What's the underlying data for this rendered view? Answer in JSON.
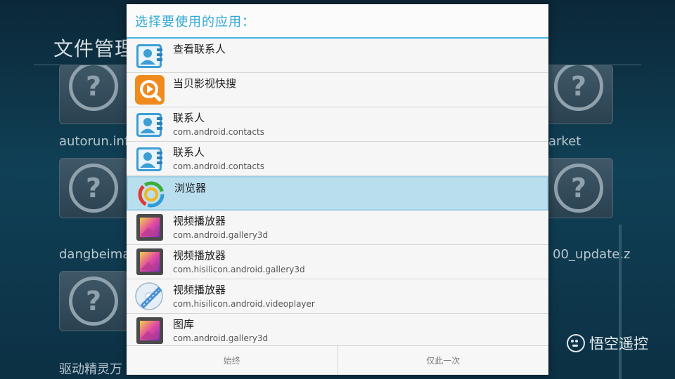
{
  "background": {
    "title": "文件管理",
    "labels": {
      "autorun": "autorun.inf",
      "market": "arket",
      "dangbei": "dangbeima",
      "update": "00_update.z",
      "driver": "驱动精灵万"
    }
  },
  "watermark": {
    "text": "悟空遥控"
  },
  "dialog": {
    "title": "选择要使用的应用：",
    "items": [
      {
        "name": "查看联系人",
        "package": "",
        "icon": "contacts-icon"
      },
      {
        "name": "当贝影视快搜",
        "package": "",
        "icon": "dangbei-search-icon"
      },
      {
        "name": "联系人",
        "package": "com.android.contacts",
        "icon": "contacts-icon"
      },
      {
        "name": "联系人",
        "package": "com.android.contacts",
        "icon": "contacts-icon"
      },
      {
        "name": "浏览器",
        "package": "",
        "icon": "browser-icon"
      },
      {
        "name": "视频播放器",
        "package": "com.android.gallery3d",
        "icon": "gallery-icon"
      },
      {
        "name": "视频播放器",
        "package": "com.hisilicon.android.gallery3d",
        "icon": "gallery-icon"
      },
      {
        "name": "视频播放器",
        "package": "com.hisilicon.android.videoplayer",
        "icon": "videoplayer-disc-icon"
      },
      {
        "name": "图库",
        "package": "com.android.gallery3d",
        "icon": "gallery-icon"
      }
    ],
    "buttons": {
      "always": "始终",
      "once": "仅此一次"
    }
  }
}
